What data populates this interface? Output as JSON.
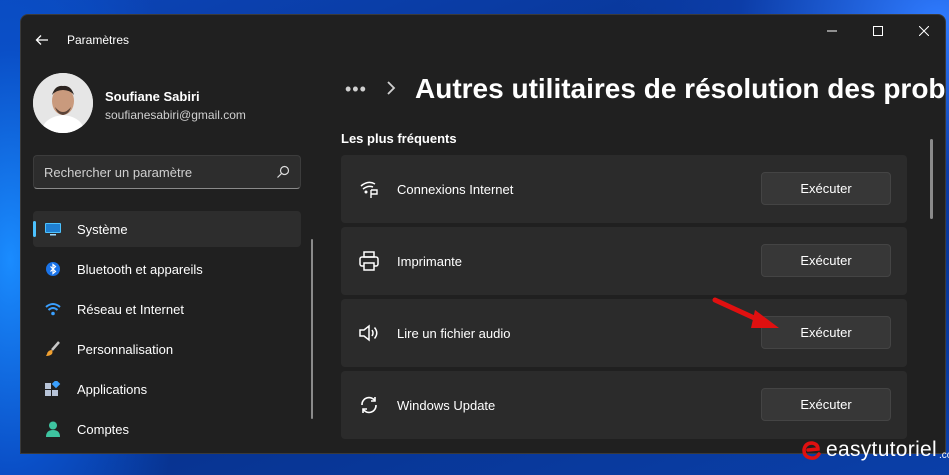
{
  "window": {
    "title": "Paramètres"
  },
  "user": {
    "name": "Soufiane Sabiri",
    "email": "soufianesabiri@gmail.com"
  },
  "search": {
    "placeholder": "Rechercher un paramètre"
  },
  "nav": [
    {
      "label": "Système",
      "icon": "monitor-icon",
      "active": true
    },
    {
      "label": "Bluetooth et appareils",
      "icon": "bluetooth-icon"
    },
    {
      "label": "Réseau et Internet",
      "icon": "wifi-icon"
    },
    {
      "label": "Personnalisation",
      "icon": "brush-icon"
    },
    {
      "label": "Applications",
      "icon": "apps-icon"
    },
    {
      "label": "Comptes",
      "icon": "person-icon"
    }
  ],
  "main": {
    "breadcrumb_more": "•••",
    "title": "Autres utilitaires de résolution des problèmes",
    "section": "Les plus fréquents",
    "items": [
      {
        "label": "Connexions Internet",
        "icon": "network-icon",
        "button": "Exécuter"
      },
      {
        "label": "Imprimante",
        "icon": "printer-icon",
        "button": "Exécuter"
      },
      {
        "label": "Lire un fichier audio",
        "icon": "speaker-icon",
        "button": "Exécuter"
      },
      {
        "label": "Windows Update",
        "icon": "sync-icon",
        "button": "Exécuter"
      }
    ]
  },
  "watermark": {
    "text": "easytutoriel",
    "suffix": ".com"
  },
  "colors": {
    "accent": "#4cc2ff",
    "window_bg": "#202020",
    "card_bg": "#2b2b2b",
    "button_bg": "#373737",
    "annotation_arrow": "#e01010"
  }
}
